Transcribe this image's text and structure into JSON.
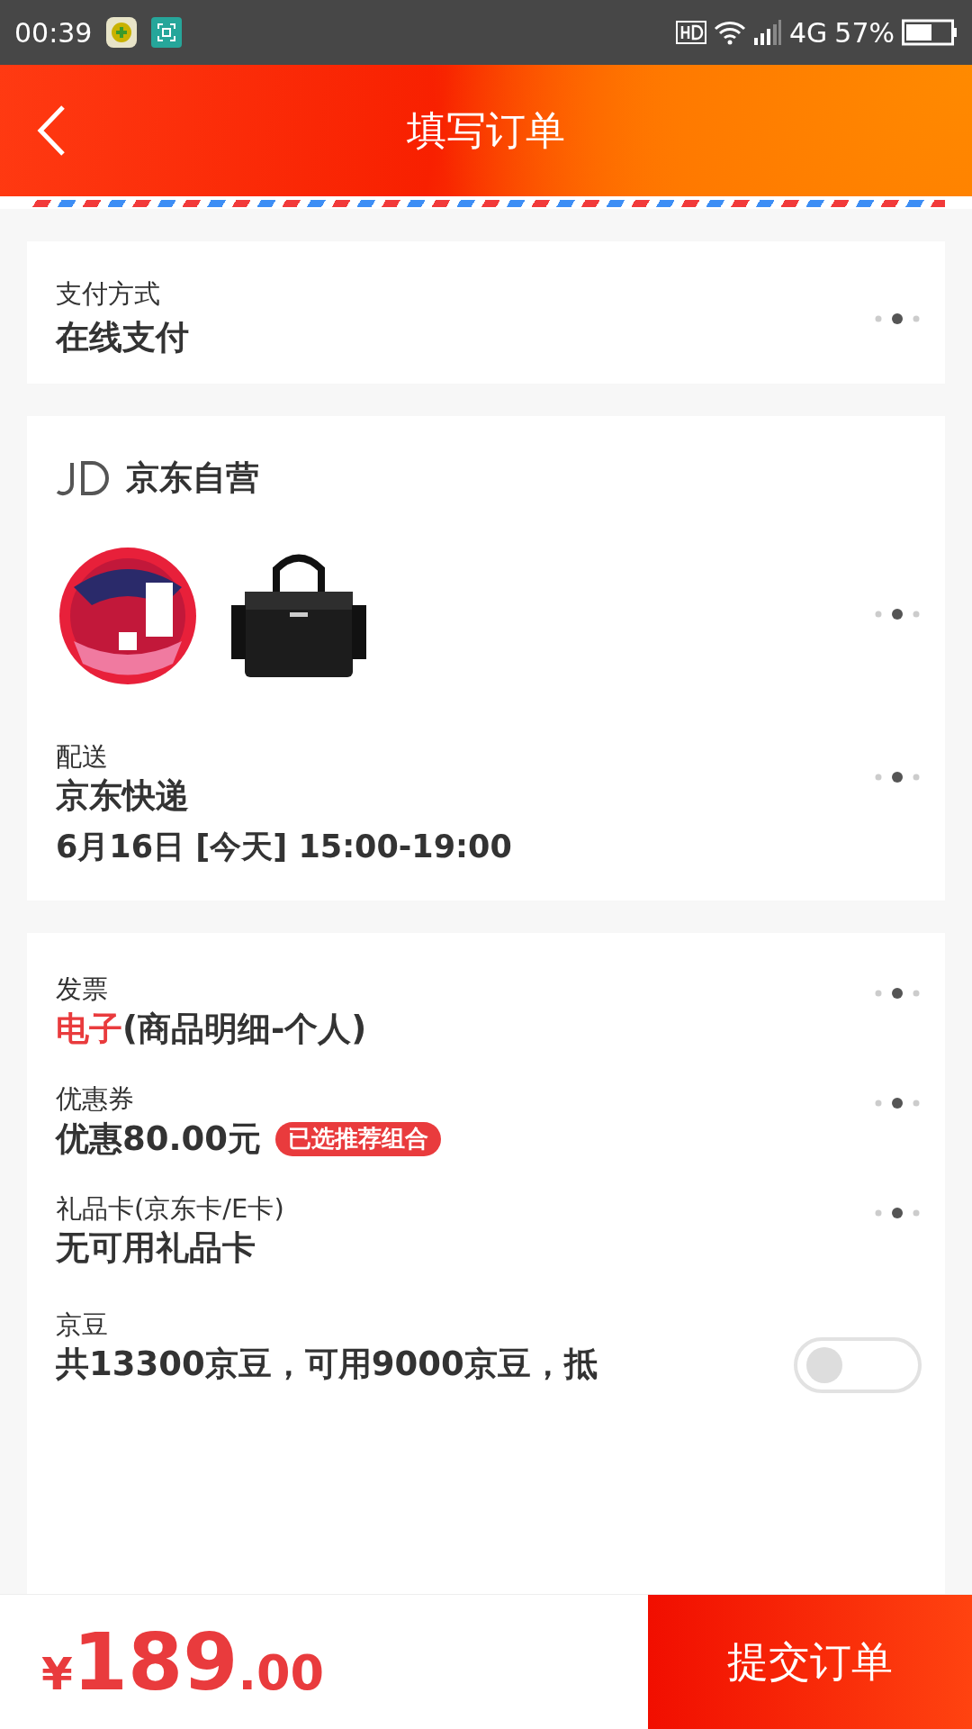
{
  "status_bar": {
    "time": "00:39",
    "network": "4G",
    "battery": "57%"
  },
  "header": {
    "title": "填写订单"
  },
  "payment": {
    "label": "支付方式",
    "value": "在线支付"
  },
  "shop": {
    "name": "京东自营",
    "delivery": {
      "label": "配送",
      "value": "京东快递",
      "time": "6月16日 [今天] 15:00-19:00"
    }
  },
  "benefits": [
    {
      "kind": "invoice",
      "label": "发票",
      "highlight": "电子",
      "value": "(商品明细-个人)"
    },
    {
      "kind": "coupon",
      "label": "优惠券",
      "value": "优惠80.00元",
      "badge": "已选推荐组合"
    },
    {
      "kind": "plain",
      "label": "礼品卡(京东卡/E卡)",
      "value": "无可用礼品卡"
    },
    {
      "kind": "toggle",
      "label": "京豆",
      "value": "共13300京豆，可用9000京豆，抵",
      "on": false
    }
  ],
  "footer": {
    "currency": "¥",
    "price_integer": "189",
    "price_decimal": ".00",
    "submit": "提交订单"
  }
}
